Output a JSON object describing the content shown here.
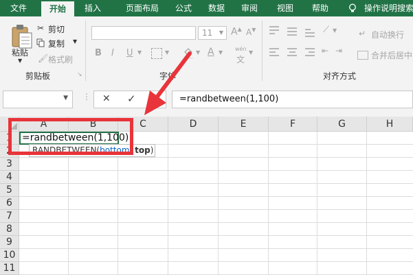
{
  "tabs": [
    {
      "label": "文件",
      "active": false
    },
    {
      "label": "开始",
      "active": true
    },
    {
      "label": "插入",
      "active": false
    },
    {
      "label": "页面布局",
      "active": false
    },
    {
      "label": "公式",
      "active": false
    },
    {
      "label": "数据",
      "active": false
    },
    {
      "label": "审阅",
      "active": false
    },
    {
      "label": "视图",
      "active": false
    },
    {
      "label": "帮助",
      "active": false
    }
  ],
  "tellme": "操作说明搜索",
  "clipboard": {
    "paste": "粘贴",
    "cut": "剪切",
    "copy": "复制",
    "format_painter": "格式刷",
    "group_label": "剪贴板"
  },
  "font": {
    "size_value": "11",
    "grow_label": "A",
    "shrink_label": "A",
    "bold": "B",
    "italic": "I",
    "underline": "U",
    "font_color": "A",
    "phonetic": "wén",
    "group_label": "字体"
  },
  "alignment": {
    "wrap_text": "自动换行",
    "merge_center": "合并后居中",
    "group_label": "对齐方式"
  },
  "formula_bar": {
    "cancel": "✕",
    "enter": "✓",
    "content": "=randbetween(1,100)"
  },
  "grid": {
    "columns": [
      "A",
      "B",
      "C",
      "D",
      "E",
      "F",
      "G",
      "H"
    ],
    "rows": [
      "1",
      "2",
      "3",
      "4",
      "5",
      "6",
      "7",
      "8",
      "9",
      "10",
      "11"
    ],
    "active_cell_text": "=randbetween(1,100)",
    "tooltip": {
      "func": "RANDBETWEEN(",
      "arg1": "bottom",
      "sep": ", ",
      "arg2": "top",
      "close": ")"
    }
  },
  "colors": {
    "accent": "#217346",
    "annotation": "#e8343a"
  }
}
